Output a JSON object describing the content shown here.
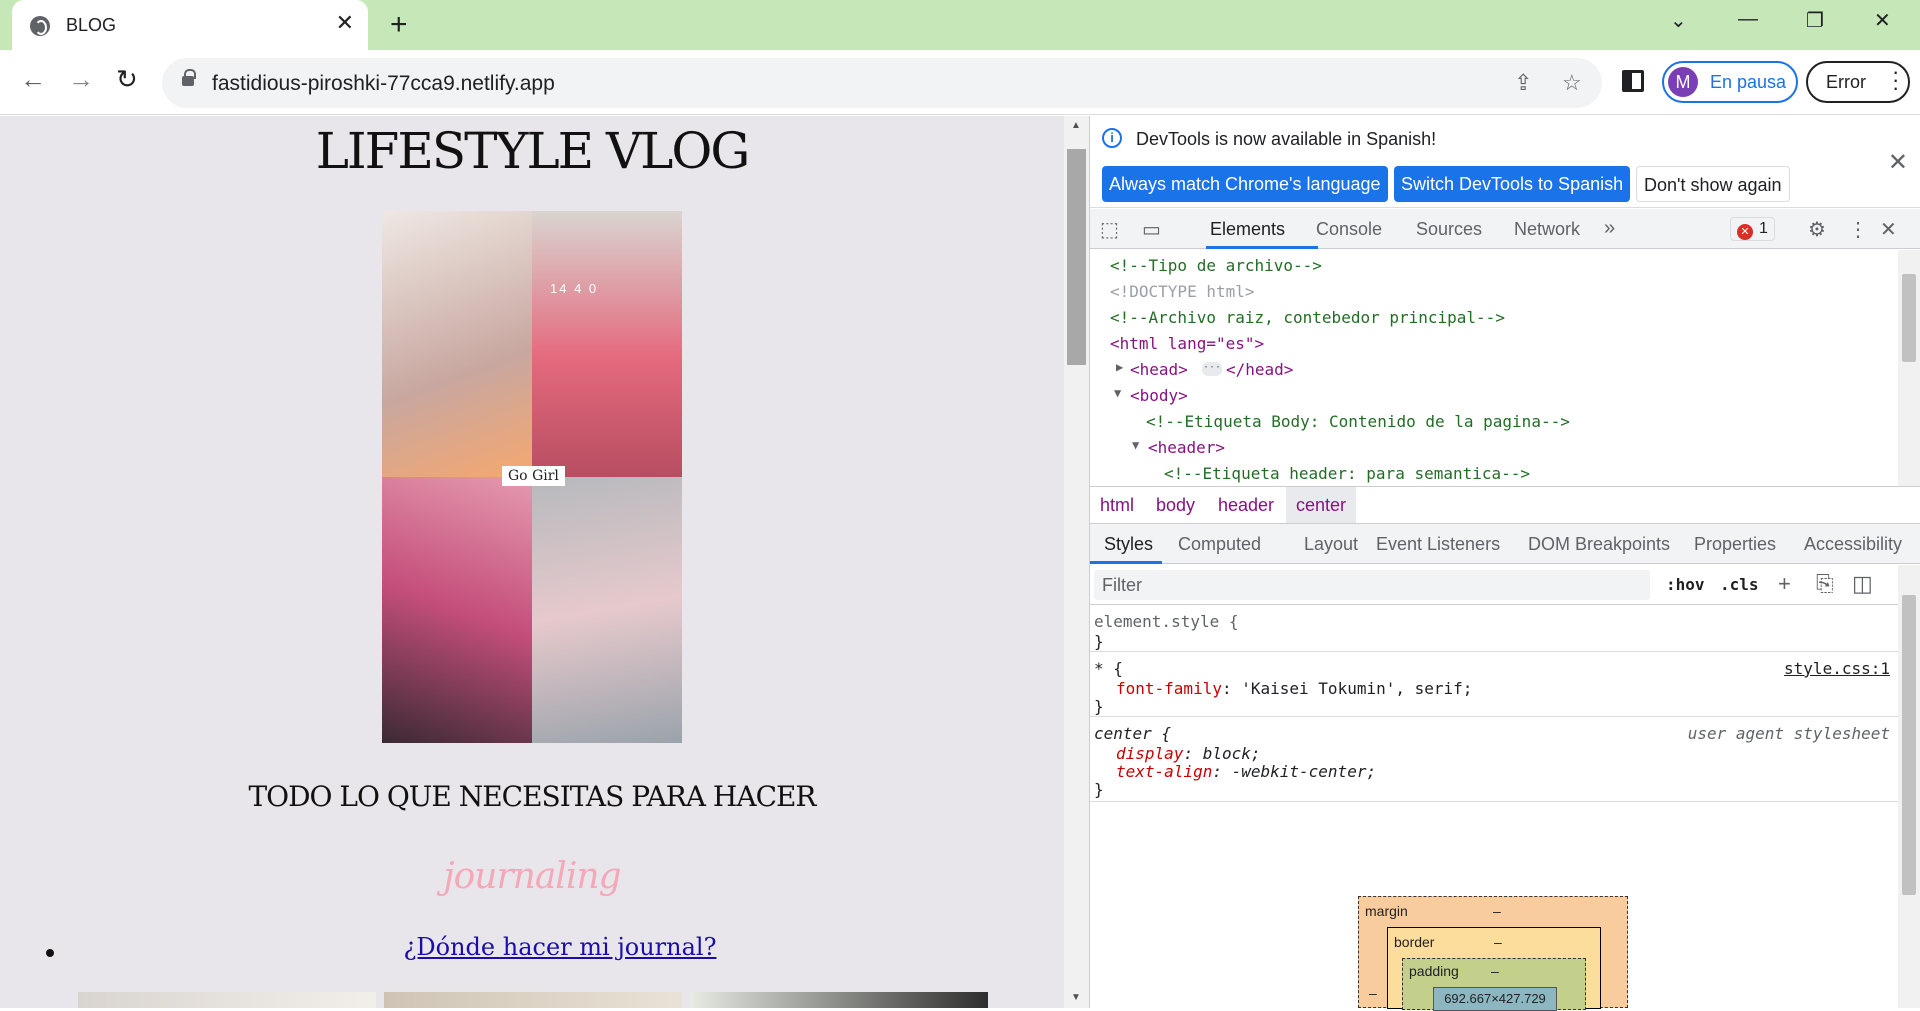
{
  "browser": {
    "tab_title": "BLOG",
    "url": "fastidious-piroshki-77cca9.netlify.app",
    "profile_initial": "M",
    "profile_label": "En pausa",
    "error_label": "Error"
  },
  "page": {
    "heading": "LIFESTYLE VLOG",
    "collage_tag": "Go Girl",
    "collage_time": "14 4 0",
    "subheading": "TODO LO QUE NECESITAS PARA HACER",
    "highlight": "journaling",
    "list_link": "¿Dónde hacer mi journal?"
  },
  "devtools": {
    "banner_message": "DevTools is now available in Spanish!",
    "banner_buttons": [
      "Always match Chrome's language",
      "Switch DevTools to Spanish",
      "Don't show again"
    ],
    "tabs": [
      "Elements",
      "Console",
      "Sources",
      "Network"
    ],
    "error_count": "1",
    "dom_lines": [
      "<!--Tipo de archivo-->",
      "<!DOCTYPE html>",
      "<!--Archivo raiz, contebedor principal-->",
      "<html lang=\"es\">",
      "<head>",
      "</head>",
      "<body>",
      "<!--Etiqueta Body: Contenido de la pagina-->",
      "<header>",
      "<!--Etiqueta header: para semantica-->"
    ],
    "breadcrumbs": [
      "html",
      "body",
      "header",
      "center"
    ],
    "style_tabs": [
      "Styles",
      "Computed",
      "Layout",
      "Event Listeners",
      "DOM Breakpoints",
      "Properties",
      "Accessibility"
    ],
    "filter_placeholder": "Filter",
    "filter_hov": ":hov",
    "filter_cls": ".cls",
    "rules": {
      "element_style": "element.style {",
      "close": "}",
      "universal_selector": "* {",
      "universal_source": "style.css:1",
      "universal_prop": "font-family",
      "universal_value": "'Kaisei Tokumin', serif;",
      "center_selector": "center {",
      "center_source": "user agent stylesheet",
      "display_prop": "display",
      "display_value": "block;",
      "align_prop": "text-align",
      "align_value": "-webkit-center;"
    },
    "box_model": {
      "margin_label": "margin",
      "border_label": "border",
      "padding_label": "padding",
      "dash": "–",
      "content_size": "692.667×427.729"
    }
  }
}
